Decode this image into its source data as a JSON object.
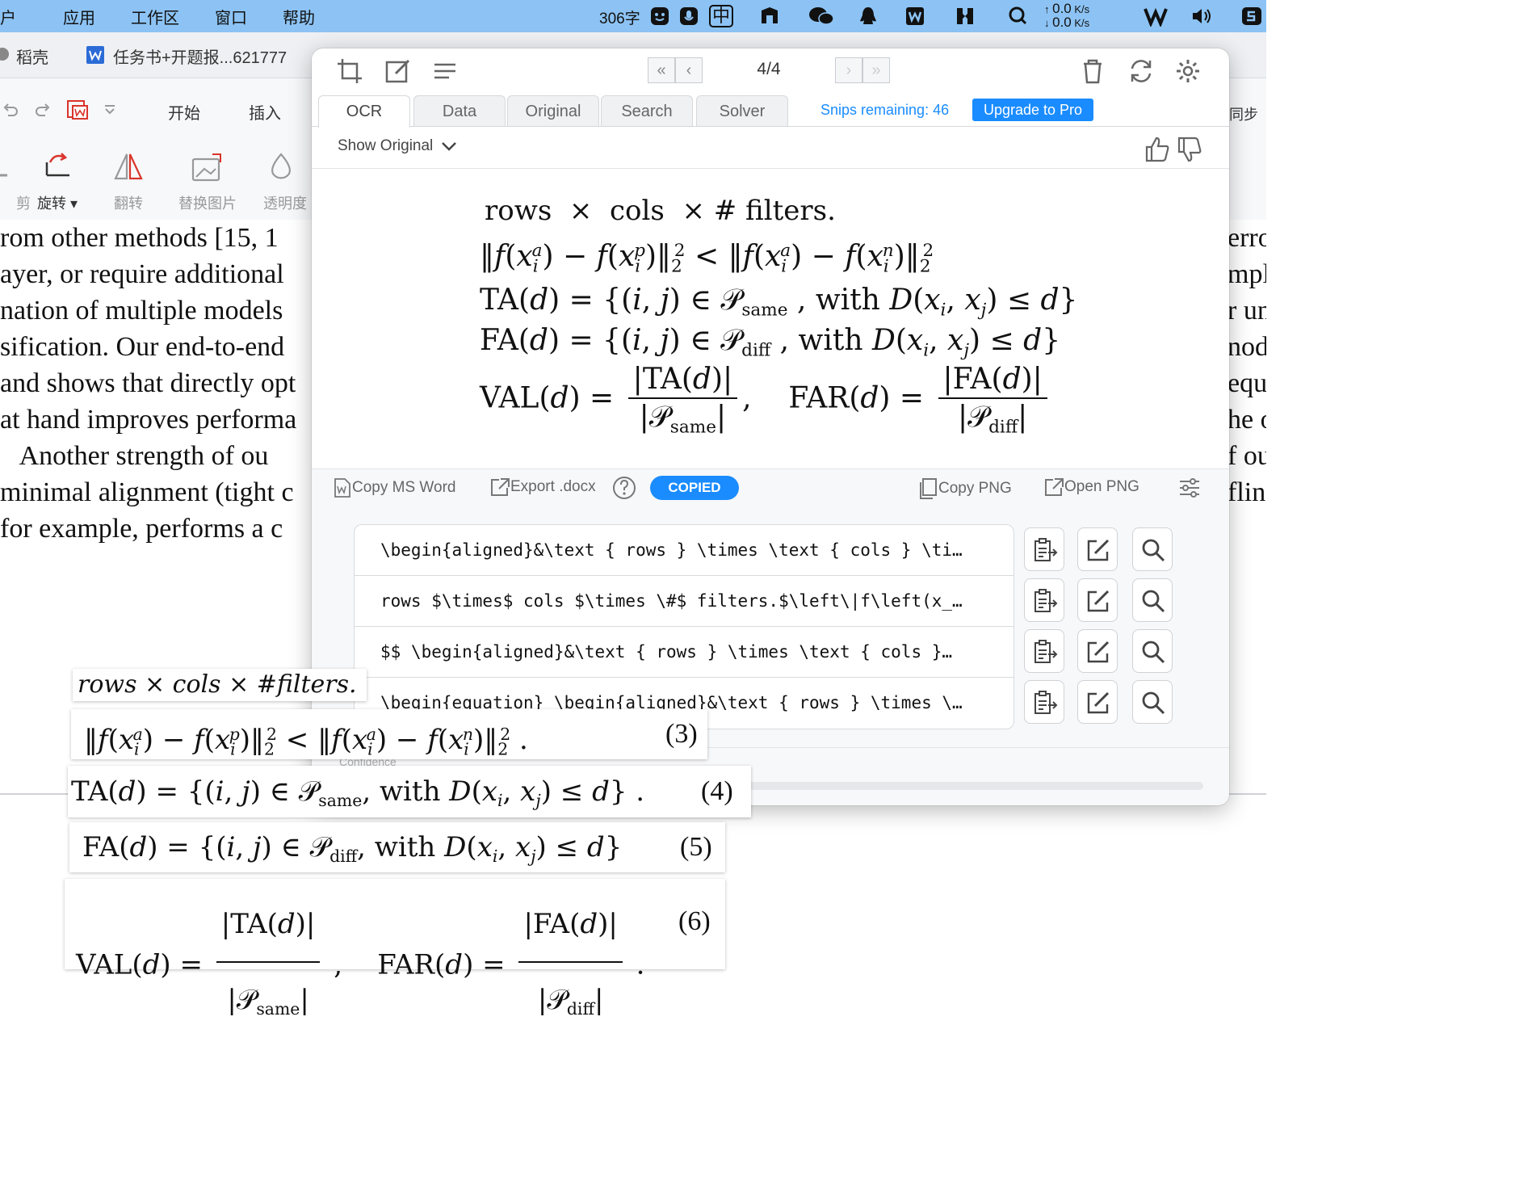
{
  "menubar": {
    "items": [
      "户",
      "应用",
      "工作区",
      "窗口",
      "帮助"
    ],
    "word_count": "306字",
    "ime_label": "中",
    "net_up": "0.0",
    "net_down": "0.0",
    "net_unit": "K/s"
  },
  "wps": {
    "tabs": [
      "稻壳",
      "任务书+开题报...621777"
    ],
    "ribbon_tabs": [
      "开始",
      "插入"
    ],
    "tools": [
      {
        "label": "剪",
        "icon": "crop-icon"
      },
      {
        "label": "旋转",
        "icon": "rotate-icon"
      },
      {
        "label": "翻转",
        "icon": "flip-icon"
      },
      {
        "label": "替换图片",
        "icon": "replace-image-icon"
      },
      {
        "label": "透明度",
        "icon": "transparency-icon"
      }
    ],
    "right_label": "同步",
    "document_lines": [
      "rom other methods [15, 1",
      "ayer, or require additional",
      "nation of multiple models",
      "sification. Our end-to-end",
      "and shows that directly opt",
      "at hand improves performa",
      "   Another strength of ou",
      "minimal alignment (tight c",
      "for example, performs a c"
    ],
    "right_lines": [
      "erro",
      "mpl",
      "r un",
      "nod",
      "equ",
      "he o",
      "f ou",
      "fline"
    ]
  },
  "mathpix": {
    "pager": "4/4",
    "tabs": [
      "OCR",
      "Data",
      "Original",
      "Search",
      "Solver"
    ],
    "active_tab": "OCR",
    "snips_remaining": "Snips remaining: 46",
    "upgrade_label": "Upgrade to Pro",
    "show_original": "Show Original",
    "render": {
      "line1": {
        "a": "rows",
        "b": "cols",
        "c": "# filters."
      },
      "ta": {
        "lhs": "TA(",
        "set": "same",
        "with": "with"
      },
      "fa": {
        "lhs": "FA(",
        "set": "diff",
        "with": "with"
      },
      "val": {
        "name": "VAL",
        "far": "FAR",
        "ta": "TA",
        "fa": "FA",
        "same": "same",
        "diff": "diff"
      }
    },
    "actions": {
      "copy_word": "Copy MS Word",
      "export_docx": "Export .docx",
      "copied": "COPIED",
      "copy_png": "Copy PNG",
      "open_png": "Open PNG"
    },
    "results": [
      "\\begin{aligned}&\\text { rows } \\times \\text { cols } \\ti…",
      "rows $\\times$ cols $\\times \\#$ filters.$\\left\\|f\\left(x_…",
      "$$ \\begin{aligned}&\\text { rows } \\times \\text { cols }…",
      "\\begin{equation} \\begin{aligned}&\\text { rows } \\times \\…"
    ],
    "confidence_label": "Confidence"
  },
  "snippets": {
    "s1": "rows × cols × #filters.",
    "eq3": "(3)",
    "eq4": "(4)",
    "eq5": "(5)",
    "eq6": "(6)",
    "same": "same",
    "diff": "diff",
    "with": "with"
  },
  "colors": {
    "menubar": "#8cc3f4",
    "accent": "#1a8cff",
    "wps_accent": "#d9342b"
  }
}
